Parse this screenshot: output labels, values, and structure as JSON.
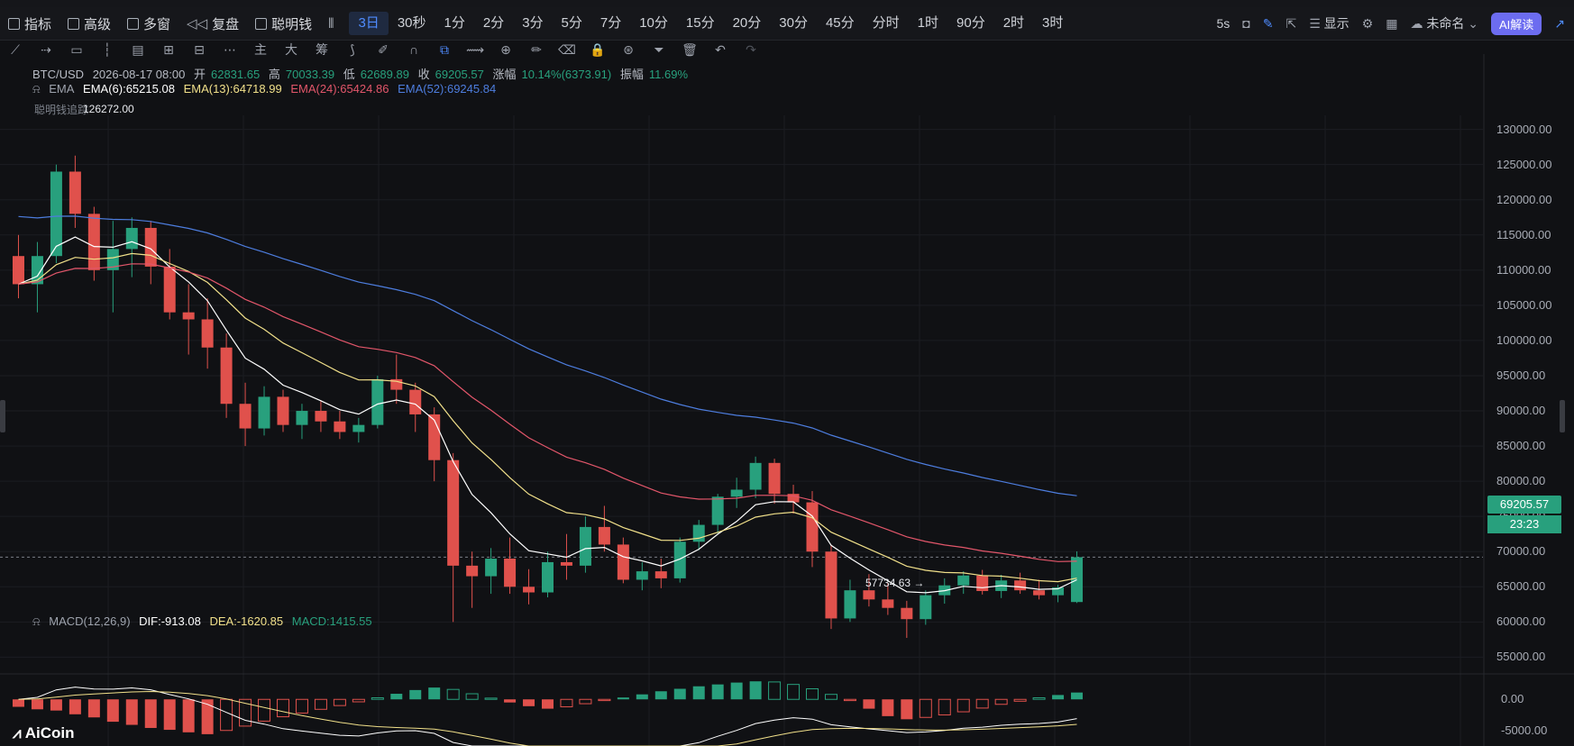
{
  "toolbar": {
    "indicator_label": "指标",
    "advanced_label": "高级",
    "multiwindow_label": "多窗",
    "replay_label": "复盘",
    "smartmoney_label": "聪明钱",
    "intervals": [
      "3日",
      "30秒",
      "1分",
      "2分",
      "3分",
      "5分",
      "7分",
      "10分",
      "15分",
      "20分",
      "30分",
      "45分",
      "分时",
      "1时",
      "90分",
      "2时",
      "3时"
    ],
    "active_interval": "3日",
    "refresh_label": "5s",
    "display_label": "显示",
    "unnamed_label": "未命名",
    "ai_label": "AI解读"
  },
  "drawtools": {
    "labels": [
      "主",
      "大",
      "筹"
    ]
  },
  "legend": {
    "symbol": "BTC/USD",
    "datetime": "2026-08-17 08:00",
    "open_label": "开",
    "open": "62831.65",
    "high_label": "高",
    "high": "70033.39",
    "low_label": "低",
    "low": "62689.89",
    "close_label": "收",
    "close": "69205.57",
    "change_label": "涨幅",
    "change": "10.14%(6373.91)",
    "amp_label": "振幅",
    "amp": "11.69%",
    "ema_title": "EMA",
    "ema6": "EMA(6):65215.08",
    "ema13": "EMA(13):64718.99",
    "ema24": "EMA(24):65424.86",
    "ema52": "EMA(52):69245.84",
    "macd_title": "MACD(12,26,9)",
    "dif": "DIF:-913.08",
    "dea": "DEA:-1620.85",
    "macd": "MACD:1415.55"
  },
  "annotations": {
    "high_marker": "126272.00",
    "low_marker": "57734.63 →",
    "watermark": "聪明钱追踪"
  },
  "price_axis": {
    "ticks": [
      "130000.00",
      "125000.00",
      "120000.00",
      "115000.00",
      "110000.00",
      "105000.00",
      "100000.00",
      "95000.00",
      "90000.00",
      "85000.00",
      "80000.00",
      "75000.00",
      "70000.00",
      "65000.00",
      "60000.00",
      "55000.00"
    ],
    "last_price": "69205.57",
    "countdown": "23:23"
  },
  "macd_axis": {
    "ticks": [
      "0.00",
      "-5000.00"
    ]
  },
  "colors": {
    "up": "#28a07d",
    "down": "#e0514c",
    "ema6": "#ffffff",
    "ema13": "#f1e08a",
    "ema24": "#e2566a",
    "ema52": "#4d7dde",
    "dif": "#ffffff",
    "dea": "#f1e08a"
  },
  "logo": "AiCoin",
  "chart_data": {
    "type": "candlestick",
    "symbol": "BTC/USD",
    "price_range": [
      53000,
      132000
    ],
    "macd_range": [
      -7500,
      3800
    ],
    "candles": [
      [
        112000,
        115000,
        106000,
        108000
      ],
      [
        108000,
        114000,
        104000,
        112000
      ],
      [
        112000,
        125000,
        111000,
        124000
      ],
      [
        124000,
        126272,
        116000,
        118000
      ],
      [
        118000,
        119000,
        108500,
        110000
      ],
      [
        110000,
        117000,
        104000,
        113000
      ],
      [
        113000,
        117500,
        109000,
        116000
      ],
      [
        116000,
        117000,
        108000,
        110500
      ],
      [
        110500,
        113000,
        103000,
        104000
      ],
      [
        104000,
        108000,
        98000,
        103000
      ],
      [
        103000,
        106000,
        96000,
        99000
      ],
      [
        99000,
        101000,
        89000,
        91000
      ],
      [
        91000,
        94000,
        85000,
        87500
      ],
      [
        87500,
        93500,
        86500,
        92000
      ],
      [
        92000,
        93000,
        87000,
        88000
      ],
      [
        88000,
        91000,
        86000,
        90000
      ],
      [
        90000,
        91500,
        87000,
        88500
      ],
      [
        88500,
        90000,
        86000,
        87000
      ],
      [
        87000,
        89000,
        85500,
        88000
      ],
      [
        88000,
        95000,
        87500,
        94500
      ],
      [
        94500,
        98000,
        91000,
        93000
      ],
      [
        93000,
        94000,
        87000,
        89500
      ],
      [
        89500,
        90500,
        80000,
        83000
      ],
      [
        83000,
        84000,
        60000,
        68000
      ],
      [
        68000,
        70000,
        62000,
        66500
      ],
      [
        66500,
        70500,
        64000,
        69000
      ],
      [
        69000,
        72000,
        64000,
        65000
      ],
      [
        65000,
        67500,
        62500,
        64200
      ],
      [
        64200,
        70000,
        63500,
        68500
      ],
      [
        68500,
        72500,
        66000,
        68000
      ],
      [
        68000,
        75000,
        67000,
        73500
      ],
      [
        73500,
        76500,
        70000,
        71000
      ],
      [
        71000,
        72000,
        65500,
        66000
      ],
      [
        66000,
        68500,
        64500,
        67200
      ],
      [
        67200,
        69000,
        64800,
        66200
      ],
      [
        66200,
        72000,
        65600,
        71400
      ],
      [
        71400,
        74500,
        70200,
        73800
      ],
      [
        73800,
        78200,
        72600,
        77800
      ],
      [
        77800,
        80500,
        76200,
        78800
      ],
      [
        78800,
        83500,
        77600,
        82600
      ],
      [
        82600,
        83200,
        76800,
        78200
      ],
      [
        78200,
        79500,
        75400,
        77000
      ],
      [
        77000,
        78600,
        67800,
        70000
      ],
      [
        70000,
        71000,
        59000,
        60500
      ],
      [
        60500,
        66000,
        60000,
        64500
      ],
      [
        64500,
        66800,
        62200,
        63200
      ],
      [
        63200,
        65500,
        61000,
        62000
      ],
      [
        62000,
        63000,
        57734.63,
        60400
      ],
      [
        60400,
        64500,
        59600,
        63800
      ],
      [
        63800,
        66200,
        62600,
        65200
      ],
      [
        65200,
        67200,
        64000,
        66600
      ],
      [
        66600,
        67400,
        63900,
        64400
      ],
      [
        64400,
        66700,
        63400,
        65900
      ],
      [
        65900,
        67000,
        64000,
        64500
      ],
      [
        64500,
        66000,
        63200,
        63800
      ],
      [
        63800,
        65300,
        62800,
        64900
      ],
      [
        62831.65,
        70033.39,
        62689.89,
        69205.57
      ]
    ],
    "macd_hist": [
      -1200,
      -1600,
      -1800,
      -2400,
      -2900,
      -3600,
      -4100,
      -4600,
      -4900,
      -5300,
      -5600,
      -5000,
      -4300,
      -3500,
      -2800,
      -2200,
      -1600,
      -1000,
      -400,
      250,
      900,
      1500,
      1900,
      1600,
      900,
      200,
      -500,
      -1100,
      -1500,
      -1200,
      -700,
      -200,
      300,
      800,
      1300,
      1700,
      2100,
      2400,
      2700,
      2900,
      2800,
      2400,
      1700,
      800,
      -200,
      -1500,
      -2700,
      -3200,
      -2900,
      -2500,
      -2000,
      -1400,
      -800,
      -300,
      250,
      700,
      1100,
      1415.55
    ]
  }
}
